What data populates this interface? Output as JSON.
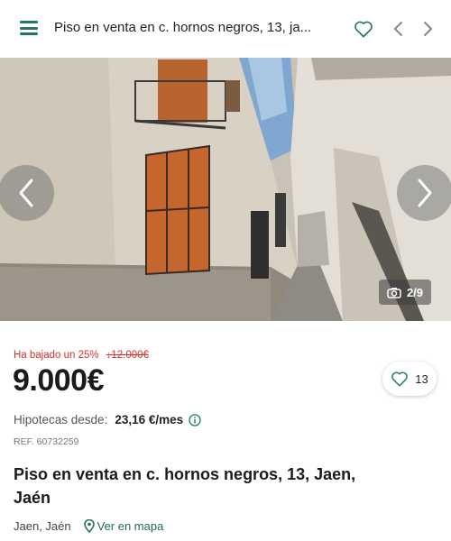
{
  "header": {
    "title": "Piso en venta en c. hornos negros, 13, ja..."
  },
  "gallery": {
    "counter": "2/9"
  },
  "listing": {
    "price_drop_label": "Ha bajado un 25%",
    "old_price": "↓12.000€",
    "price": "9.000€",
    "favorites_count": "13",
    "mortgage_label": "Hipotecas desde:",
    "mortgage_amount": "23,16 €/mes",
    "reference": "REF. 60732259",
    "title": "Piso en venta en c. hornos negros, 13, Jaen, Jaén",
    "location": "Jaen, Jaén",
    "map_link": "Ver en mapa"
  },
  "colors": {
    "accent": "#1d7a5f",
    "price_drop": "#d0312d"
  },
  "icons": [
    "menu-icon",
    "heart-icon",
    "chevron-left-icon",
    "chevron-right-icon",
    "camera-icon",
    "info-icon",
    "map-pin-icon"
  ]
}
